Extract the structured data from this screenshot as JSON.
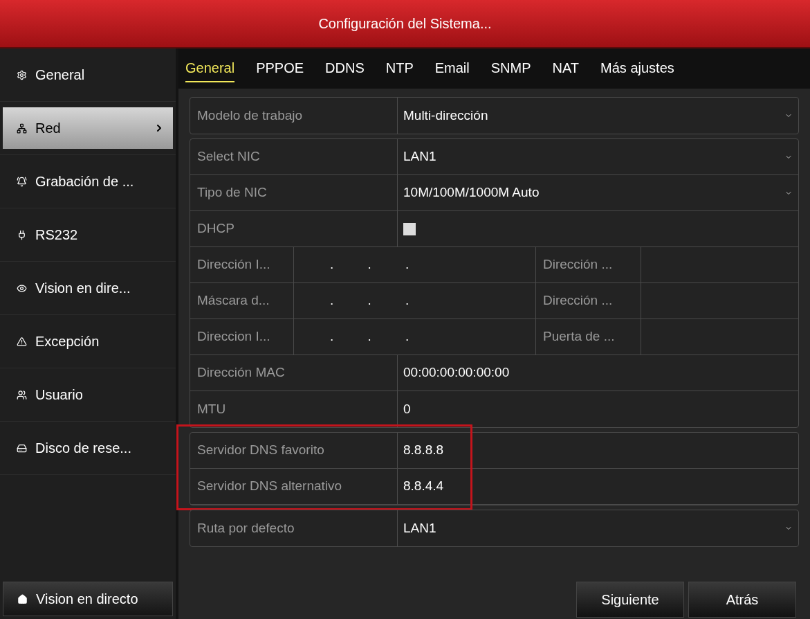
{
  "window": {
    "title": "Configuración del Sistema..."
  },
  "sidebar": {
    "items": [
      {
        "label": "General",
        "selected": false
      },
      {
        "label": "Red",
        "selected": true
      },
      {
        "label": "Grabación de ...",
        "selected": false
      },
      {
        "label": "RS232",
        "selected": false
      },
      {
        "label": "Vision en dire...",
        "selected": false
      },
      {
        "label": "Excepción",
        "selected": false
      },
      {
        "label": "Usuario",
        "selected": false
      },
      {
        "label": "Disco de rese...",
        "selected": false
      }
    ],
    "bottom_button": "Vision en directo"
  },
  "tabs": [
    {
      "label": "General",
      "selected": true
    },
    {
      "label": "PPPOE",
      "selected": false
    },
    {
      "label": "DDNS",
      "selected": false
    },
    {
      "label": "NTP",
      "selected": false
    },
    {
      "label": "Email",
      "selected": false
    },
    {
      "label": "SNMP",
      "selected": false
    },
    {
      "label": "NAT",
      "selected": false
    },
    {
      "label": "Más ajustes",
      "selected": false
    }
  ],
  "groups": [
    {
      "highlighted": false,
      "rows": [
        {
          "kind": "select",
          "label": "Modelo de trabajo",
          "value": "Multi-dirección"
        }
      ]
    },
    {
      "highlighted": false,
      "rows": [
        {
          "kind": "select",
          "label": "Select NIC",
          "value": "LAN1"
        },
        {
          "kind": "select",
          "label": "Tipo de NIC",
          "value": "10M/100M/1000M Auto"
        },
        {
          "kind": "checkbox",
          "label": "DHCP",
          "checked": false
        },
        {
          "kind": "split",
          "label": "Dirección I...",
          "value": ". . .",
          "label_2": "Dirección ..."
        },
        {
          "kind": "split",
          "label": "Máscara d...",
          "value": ". . .",
          "label_2": "Dirección ..."
        },
        {
          "kind": "split",
          "label": "Direccion I...",
          "value": ". . .",
          "label_2": "Puerta de ..."
        },
        {
          "kind": "text",
          "label": "Dirección MAC",
          "value": "00:00:00:00:00:00"
        },
        {
          "kind": "text",
          "label": "MTU",
          "value": "0"
        }
      ]
    },
    {
      "highlighted": true,
      "rows": [
        {
          "kind": "text",
          "label": "Servidor DNS favorito",
          "value": "8.8.8.8"
        },
        {
          "kind": "text",
          "label": "Servidor DNS alternativo",
          "value": "8.8.4.4"
        }
      ]
    },
    {
      "highlighted": false,
      "rows": [
        {
          "kind": "select",
          "label": "Ruta por defecto",
          "value": "LAN1"
        }
      ]
    }
  ],
  "buttons": [
    "Siguiente",
    "Atrás"
  ]
}
